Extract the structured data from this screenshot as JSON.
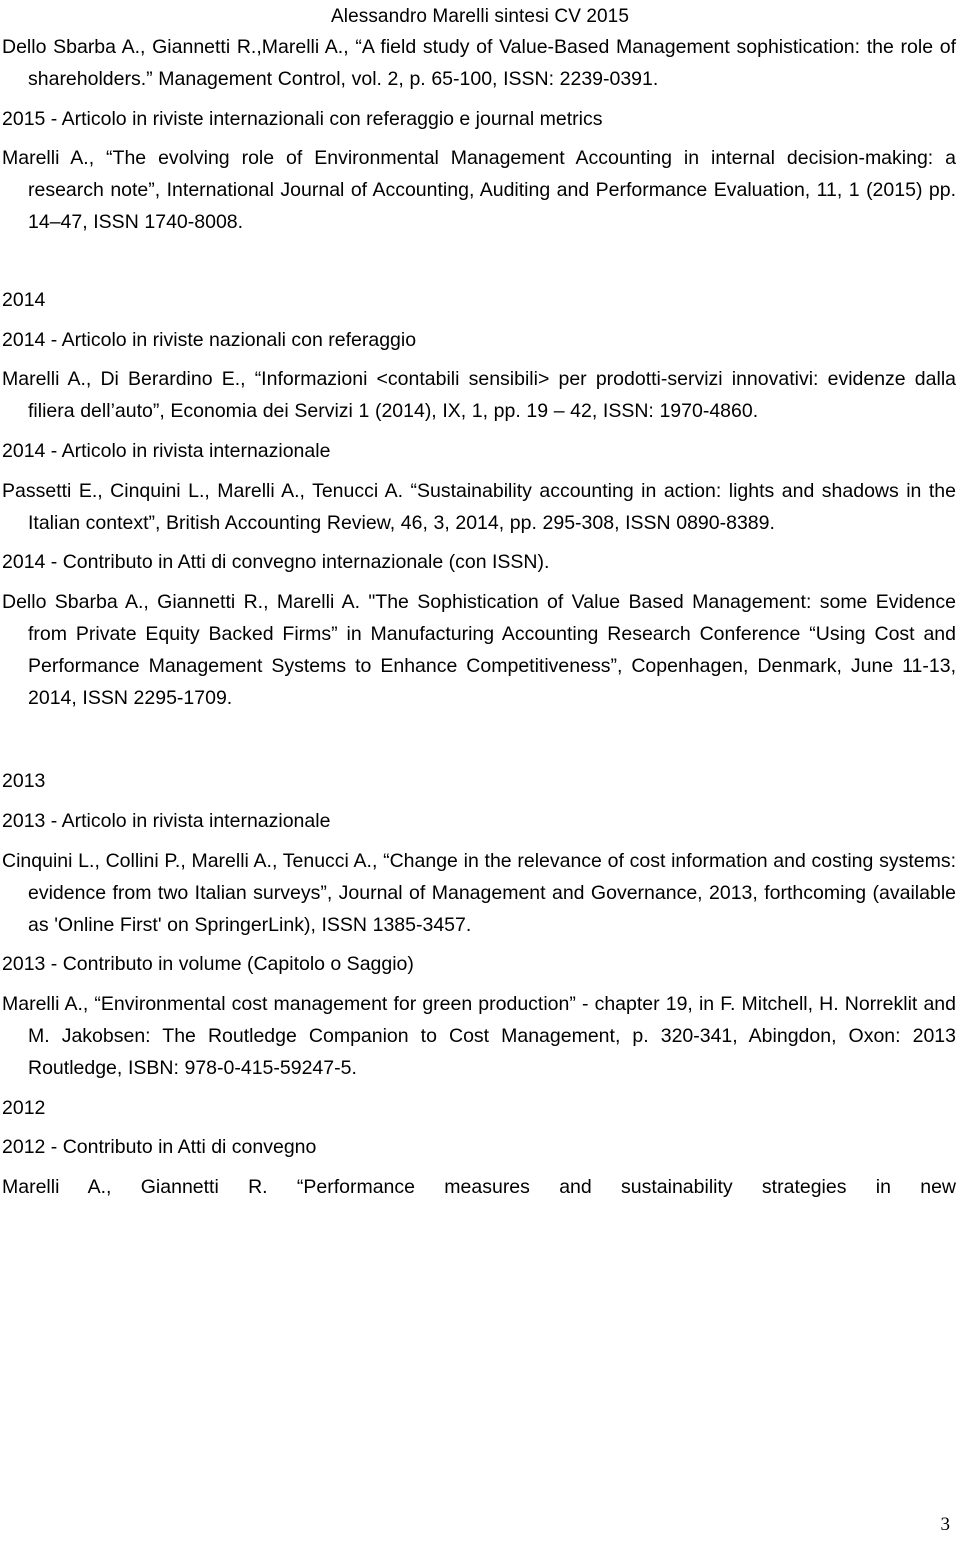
{
  "document": {
    "header": "Alessandro Marelli sintesi  CV 2015",
    "page_number": "3"
  },
  "content": {
    "ref_2015_mc": "Dello Sbarba A., Giannetti R.,Marelli A., “A field study of Value-Based Management sophistication: the role of shareholders.” Management Control, vol. 2, p. 65-100, ISSN: 2239-0391.",
    "subhead_2015_intl": "2015 - Articolo in riviste internazionali con referaggio e journal metrics",
    "ref_2015_ijaape": "Marelli A., “The evolving role of Environmental Management Accounting in internal decision-making: a research note”, International Journal of Accounting, Auditing and Performance Evaluation, 11, 1 (2015) pp. 14–47, ISSN 1740-8008.",
    "year_2014": "2014",
    "subhead_2014_naz": "2014 - Articolo in riviste nazionali con referaggio",
    "ref_2014_eds": "Marelli A.,   Di Berardino E., “Informazioni <contabili sensibili> per prodotti-servizi innovativi: evidenze dalla filiera dell’auto”,  Economia dei Servizi 1 (2014),  IX, 1, pp. 19 – 42, ISSN: 1970-4860.",
    "subhead_2014_intl": "2014 - Articolo in rivista internazionale",
    "ref_2014_bar": "Passetti E., Cinquini L., Marelli A., Tenucci A. “Sustainability accounting in action: lights and shadows in the Italian context”, British Accounting Review, 46, 3, 2014, pp. 295-308, ISSN 0890-8389.",
    "subhead_2014_atti": "2014 - Contributo in Atti di convegno internazionale (con ISSN).",
    "ref_2014_conf": "Dello Sbarba A., Giannetti R., Marelli A. \"The Sophistication of Value Based Management: some Evidence from Private Equity Backed Firms” in Manufacturing Accounting Research Conference “Using Cost and Performance Management Systems to Enhance Competitiveness”, Copenhagen, Denmark, June 11-13, 2014, ISSN 2295-1709.",
    "year_2013": "2013",
    "subhead_2013_intl": "2013 - Articolo in rivista internazionale",
    "ref_2013_jmg": "Cinquini L., Collini P., Marelli A., Tenucci A., “Change in the relevance of cost information and costing systems: evidence from two Italian surveys”, Journal of Management and Governance, 2013, forthcoming (available as 'Online First' on SpringerLink), ISSN 1385-3457.",
    "subhead_2013_vol": "2013 - Contributo in volume (Capitolo o Saggio)",
    "ref_2013_routledge": "Marelli A., “Environmental cost management for green production” - chapter 19, in F. Mitchell, H. Norreklit and M. Jakobsen: The Routledge Companion to Cost Management, p. 320-341, Abingdon, Oxon: 2013 Routledge, ISBN: 978-0-415-59247-5.",
    "year_2012": "2012",
    "subhead_2012_atti": "2012 - Contributo in Atti di convegno",
    "ref_2012_perf": "Marelli A., Giannetti R. “Performance measures and sustainability strategies in new"
  }
}
